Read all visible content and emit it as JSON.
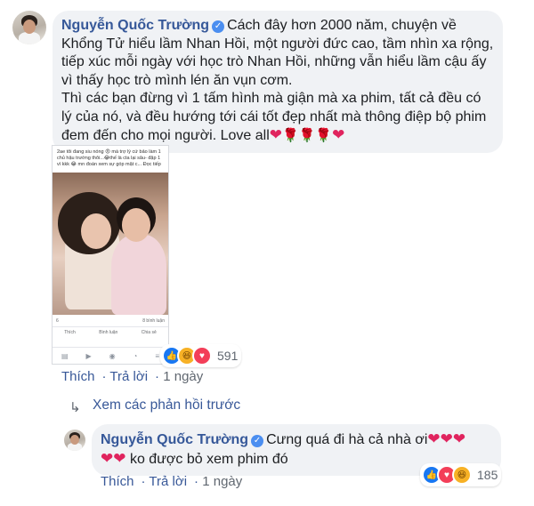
{
  "comment": {
    "author": "Nguyễn Quốc Trường",
    "text": "Cách đây hơn 2000 năm, chuyện về Khổng Tử hiểu lầm Nhan Hồi, một người đức cao, tầm nhìn xa rộng, tiếp xúc mỗi ngày với học trò Nhan Hồi, những vẫn hiểu lầm cậu ấy vì thấy học trò mình lén ăn vụn cơm.",
    "text2": "Thì các bạn đừng vì 1 tấm hình mà giận mà xa phim, tất cả đều có lý của nó, và đều hướng tới cái tốt đẹp nhất mà thông điệp bộ phim đem đến cho mọi người. Love all",
    "reaction_count": "591",
    "actions": {
      "like": "Thích",
      "reply": "Trả lời",
      "time": "1 ngày"
    }
  },
  "embedded_post": {
    "caption": "2ae tôi đang siu nóng 😡 mà trợ lý cứ bảo làm 1 chủ hậu trường thôi...😂thế là cta lại sâu- đặp 1 vì kkk 😂 mn đoán xem sự góp mặt c... Đọc tiếp",
    "reactions": "6",
    "comments_count": "8 bình luận",
    "like_label": "Thích",
    "comment_label": "Bình luận",
    "share_label": "Chia sẻ"
  },
  "view_previous": "Xem các phản hồi trước",
  "reply": {
    "author": "Nguyễn Quốc Trường",
    "text": "Cưng quá đi hà cả nhà ơi",
    "text2": "ko được bỏ xem phim đó",
    "reaction_count": "185",
    "actions": {
      "like": "Thích",
      "reply": "Trả lời",
      "time": "1 ngày"
    }
  },
  "icons": [
    "verified-icon",
    "heart-icon",
    "rose-icon",
    "like-reaction-icon",
    "haha-reaction-icon",
    "love-reaction-icon",
    "reply-arrow-icon"
  ],
  "colors": {
    "link": "#385898",
    "name": "#365899",
    "bubble": "#f0f2f5",
    "verified": "#4b8ef0"
  }
}
